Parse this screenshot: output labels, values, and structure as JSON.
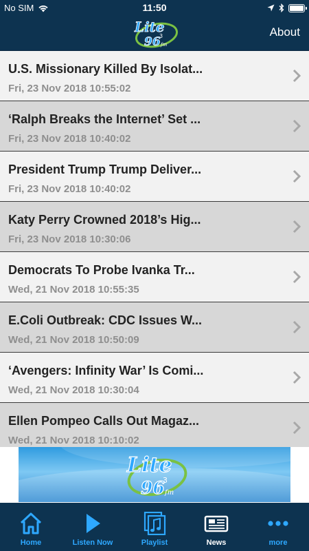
{
  "status_bar": {
    "carrier": "No SIM",
    "time": "11:50"
  },
  "nav_bar": {
    "logo_text": "Lite",
    "logo_number": "96",
    "logo_superscript": "3",
    "logo_suffix": "fm",
    "about_label": "About"
  },
  "news": [
    {
      "title": "U.S. Missionary Killed By Isolat...",
      "date": "Fri, 23 Nov 2018 10:55:02"
    },
    {
      "title": "‘Ralph Breaks the Internet’ Set ...",
      "date": "Fri, 23 Nov 2018 10:40:02"
    },
    {
      "title": "President Trump Trump Deliver...",
      "date": "Fri, 23 Nov 2018 10:40:02"
    },
    {
      "title": "Katy Perry Crowned 2018’s Hig...",
      "date": "Fri, 23 Nov 2018 10:30:06"
    },
    {
      "title": "Democrats To Probe Ivanka Tr...",
      "date": "Wed, 21 Nov 2018 10:55:35"
    },
    {
      "title": "E.Coli Outbreak: CDC Issues W...",
      "date": "Wed, 21 Nov 2018 10:50:09"
    },
    {
      "title": "‘Avengers: Infinity War’ Is Comi...",
      "date": "Wed, 21 Nov 2018 10:30:04"
    },
    {
      "title": "Ellen Pompeo Calls Out Magaz...",
      "date": "Wed, 21 Nov 2018 10:10:02"
    }
  ],
  "tabs": [
    {
      "label": "Home",
      "icon": "home-icon"
    },
    {
      "label": "Listen Now",
      "icon": "play-icon"
    },
    {
      "label": "Playlist",
      "icon": "playlist-icon"
    },
    {
      "label": "News",
      "icon": "news-icon",
      "active": true
    },
    {
      "label": "more",
      "icon": "more-icon"
    }
  ],
  "colors": {
    "bar_background": "#0d3350",
    "tab_accent": "#2ea8ff",
    "row_light": "#f2f2f2",
    "row_dark": "#d7d7d7",
    "logo_green": "#7ac143"
  }
}
